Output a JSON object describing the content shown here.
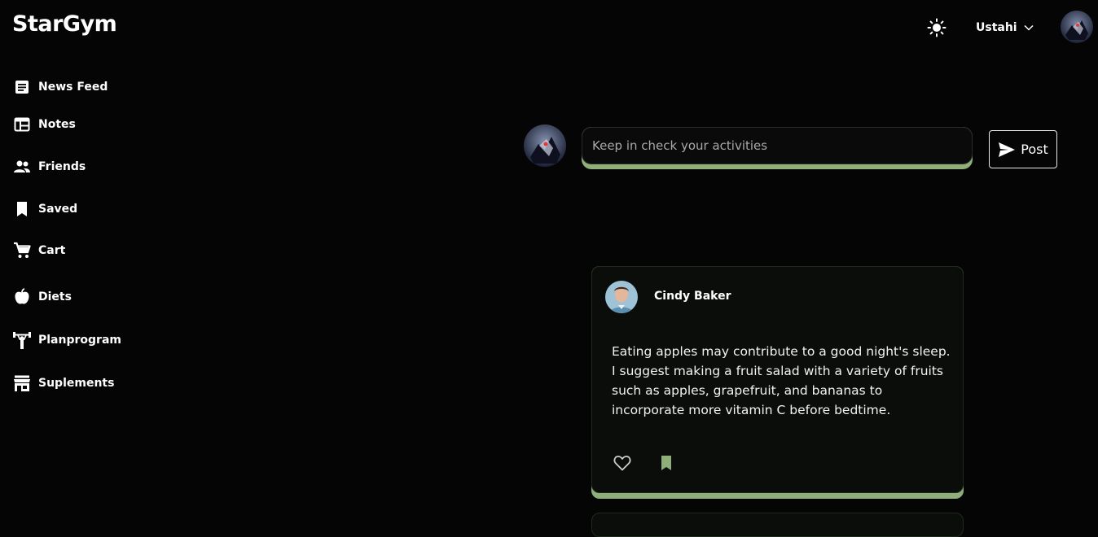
{
  "app": {
    "logo": "StarGym"
  },
  "header": {
    "theme_icon": "sun-icon",
    "user_name": "Ustahi",
    "user_menu_icon": "chevron-down-icon"
  },
  "sidebar": {
    "items": [
      {
        "label": "News Feed",
        "icon": "article-icon"
      },
      {
        "label": "Notes",
        "icon": "table-icon"
      },
      {
        "label": "Friends",
        "icon": "people-icon"
      },
      {
        "label": "Saved",
        "icon": "bookmark-icon"
      },
      {
        "label": "Cart",
        "icon": "cart-icon"
      },
      {
        "label": "Diets",
        "icon": "apple-icon"
      },
      {
        "label": "Planprogram",
        "icon": "weightlifter-icon"
      },
      {
        "label": "Suplements",
        "icon": "store-icon"
      }
    ]
  },
  "composer": {
    "placeholder": "Keep in check your activities",
    "value": "",
    "post_label": "Post"
  },
  "posts": [
    {
      "author": "Cindy Baker",
      "text": "Eating apples may contribute to a good night's sleep. I suggest making a fruit salad with a variety of fruits such as apples, grapefruit, and bananas to incorporate more vitamin C before bedtime.",
      "liked": false,
      "saved": true
    }
  ],
  "colors": {
    "accent": "#8fae7a",
    "background": "#050505",
    "card": "#0b0d0a"
  }
}
